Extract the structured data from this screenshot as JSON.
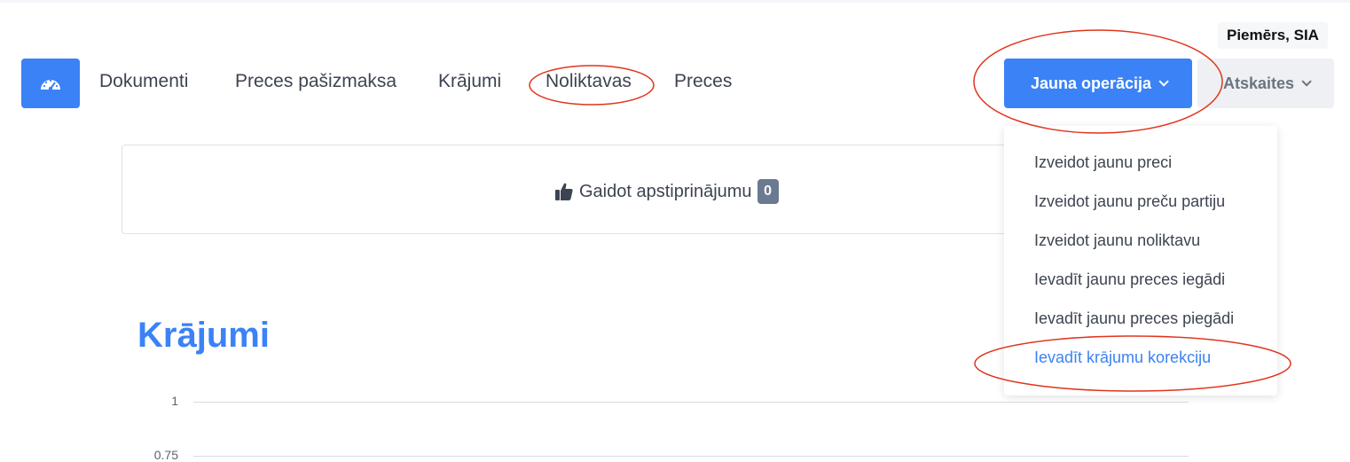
{
  "company": "Piemērs, SIA",
  "nav": {
    "items": [
      "Dokumenti",
      "Preces pašizmaksa",
      "Krājumi",
      "Noliktavas",
      "Preces"
    ]
  },
  "actions": {
    "new_operation": "Jauna operācija",
    "reports": "Atskaites"
  },
  "dropdown": {
    "items": [
      "Izveidot jaunu preci",
      "Izveidot jaunu preču partiju",
      "Izveidot jaunu noliktavu",
      "Ievadīt jaunu preces iegādi",
      "Ievadīt jaunu preces piegādi",
      "Ievadīt krājumu korekciju"
    ],
    "active_index": 5
  },
  "pending": {
    "label": "Gaidot apstiprinājumu",
    "count": "0"
  },
  "section": {
    "title": "Krājumi"
  },
  "chart_data": {
    "type": "line",
    "y_ticks": [
      "1",
      "0.75"
    ],
    "ylim": [
      0.75,
      1
    ],
    "grid": true
  },
  "colors": {
    "accent": "#3b82f6",
    "annotation": "#e0341d"
  }
}
